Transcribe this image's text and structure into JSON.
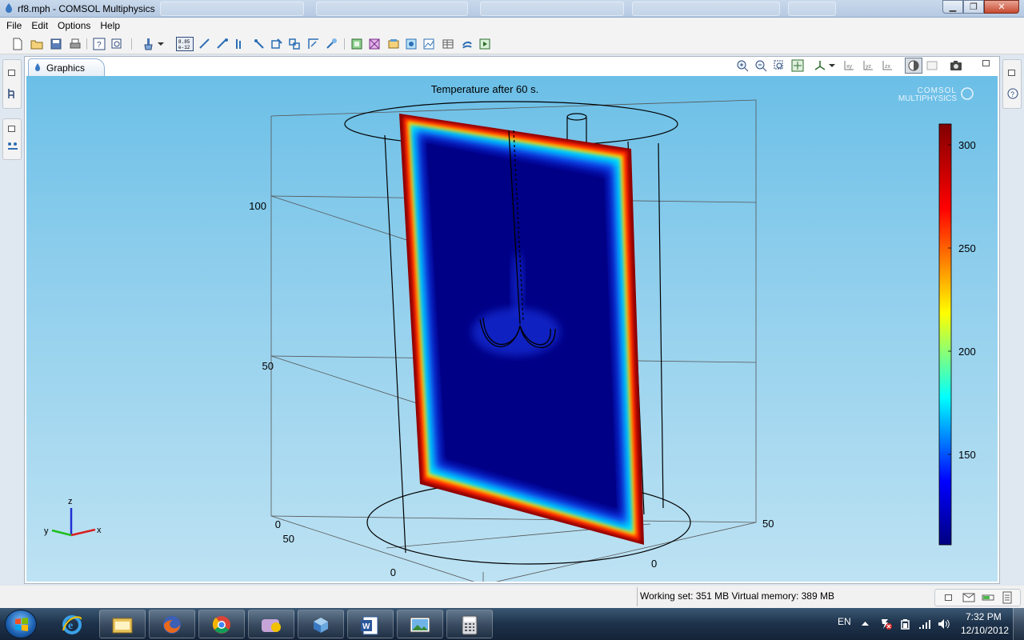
{
  "window": {
    "title": "rf8.mph - COMSOL Multiphysics",
    "minimize_glyph": "▁",
    "restore_glyph": "❐",
    "close_glyph": "✕"
  },
  "menu": {
    "items": [
      "File",
      "Edit",
      "Options",
      "Help"
    ]
  },
  "graphics": {
    "tab_label": "Graphics",
    "plot_title": "Temperature after 60 s.",
    "logo_line1": "COMSOL",
    "logo_line2": "MULTIPHYSICS",
    "z_ticks": [
      "100",
      "50",
      "0"
    ],
    "y_ticks": [
      "50",
      "0"
    ],
    "x_ticks": [
      "0",
      "50"
    ],
    "colorbar": {
      "ticks": [
        "300",
        "250",
        "200",
        "150"
      ],
      "colors": [
        "#800000",
        "#ff0000",
        "#ffff00",
        "#00ffff",
        "#0000ff",
        "#000080"
      ]
    },
    "triad": {
      "x": "x",
      "y": "y",
      "z": "z"
    }
  },
  "status": {
    "text": "Working set: 351 MB  Virtual memory: 389 MB"
  },
  "taskbar": {
    "language": "EN",
    "time": "7:32 PM",
    "date": "12/10/2012",
    "apps": [
      "explorer-icon",
      "firefox-icon",
      "chrome-icon",
      "messenger-icon",
      "comsol-icon",
      "word-icon",
      "photo-viewer-icon",
      "calculator-icon"
    ]
  }
}
